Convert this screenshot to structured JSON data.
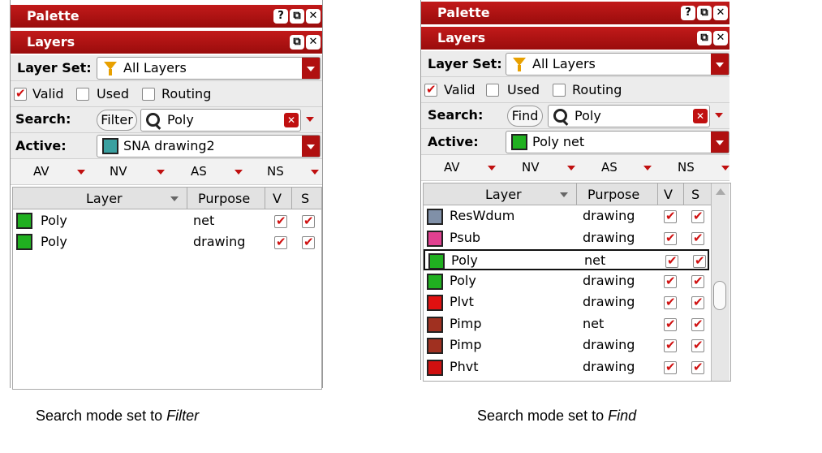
{
  "left": {
    "palette_title": "Palette",
    "layers_title": "Layers",
    "layer_set_label": "Layer Set:",
    "layer_set_value": "All Layers",
    "filters": [
      {
        "label": "Valid",
        "checked": true
      },
      {
        "label": "Used",
        "checked": false
      },
      {
        "label": "Routing",
        "checked": false
      }
    ],
    "search_label": "Search:",
    "mode_button": "Filter",
    "search_value": "Poly",
    "active_label": "Active:",
    "active_value": "SNA drawing2",
    "active_swatch": "#3aa0a0",
    "av_labels": [
      "AV",
      "NV",
      "AS",
      "NS"
    ],
    "columns": {
      "layer": "Layer",
      "purpose": "Purpose",
      "v": "V",
      "s": "S"
    },
    "rows": [
      {
        "layer": "Poly",
        "purpose": "net",
        "v": true,
        "s": true,
        "icon": "poly-green-icon",
        "color": "#20b020"
      },
      {
        "layer": "Poly",
        "purpose": "drawing",
        "v": true,
        "s": true,
        "icon": "poly-green-icon",
        "color": "#20b020"
      }
    ]
  },
  "right": {
    "palette_title": "Palette",
    "layers_title": "Layers",
    "layer_set_label": "Layer Set:",
    "layer_set_value": "All Layers",
    "filters": [
      {
        "label": "Valid",
        "checked": true
      },
      {
        "label": "Used",
        "checked": false
      },
      {
        "label": "Routing",
        "checked": false
      }
    ],
    "search_label": "Search:",
    "mode_button": "Find",
    "search_value": "Poly",
    "active_label": "Active:",
    "active_value": "Poly net",
    "active_swatch": "#20b020",
    "av_labels": [
      "AV",
      "NV",
      "AS",
      "NS"
    ],
    "columns": {
      "layer": "Layer",
      "purpose": "Purpose",
      "v": "V",
      "s": "S"
    },
    "rows": [
      {
        "layer": "ResWdum",
        "purpose": "drawing",
        "v": true,
        "s": true,
        "icon": "reswdum-icon",
        "color": "#8090a8"
      },
      {
        "layer": "Psub",
        "purpose": "drawing",
        "v": true,
        "s": true,
        "icon": "psub-icon",
        "color": "#e04090"
      },
      {
        "layer": "Poly",
        "purpose": "net",
        "v": true,
        "s": true,
        "icon": "poly-green-icon",
        "color": "#20b020",
        "selected": true
      },
      {
        "layer": "Poly",
        "purpose": "drawing",
        "v": true,
        "s": true,
        "icon": "poly-green-icon",
        "color": "#20b020"
      },
      {
        "layer": "Plvt",
        "purpose": "drawing",
        "v": true,
        "s": true,
        "icon": "plvt-icon",
        "color": "#e01010"
      },
      {
        "layer": "Pimp",
        "purpose": "net",
        "v": true,
        "s": true,
        "icon": "pimp-net-icon",
        "color": "#a03020"
      },
      {
        "layer": "Pimp",
        "purpose": "drawing",
        "v": true,
        "s": true,
        "icon": "pimp-drawing-icon",
        "color": "#a03020"
      },
      {
        "layer": "Phvt",
        "purpose": "drawing",
        "v": true,
        "s": true,
        "icon": "phvt-icon",
        "color": "#d01010"
      }
    ]
  },
  "captions": {
    "left_prefix": "Search mode set to ",
    "left_mode": "Filter",
    "right_prefix": "Search mode set to ",
    "right_mode": "Find"
  },
  "colors": {
    "title_red": "#b01010",
    "check_red": "#d01010"
  }
}
